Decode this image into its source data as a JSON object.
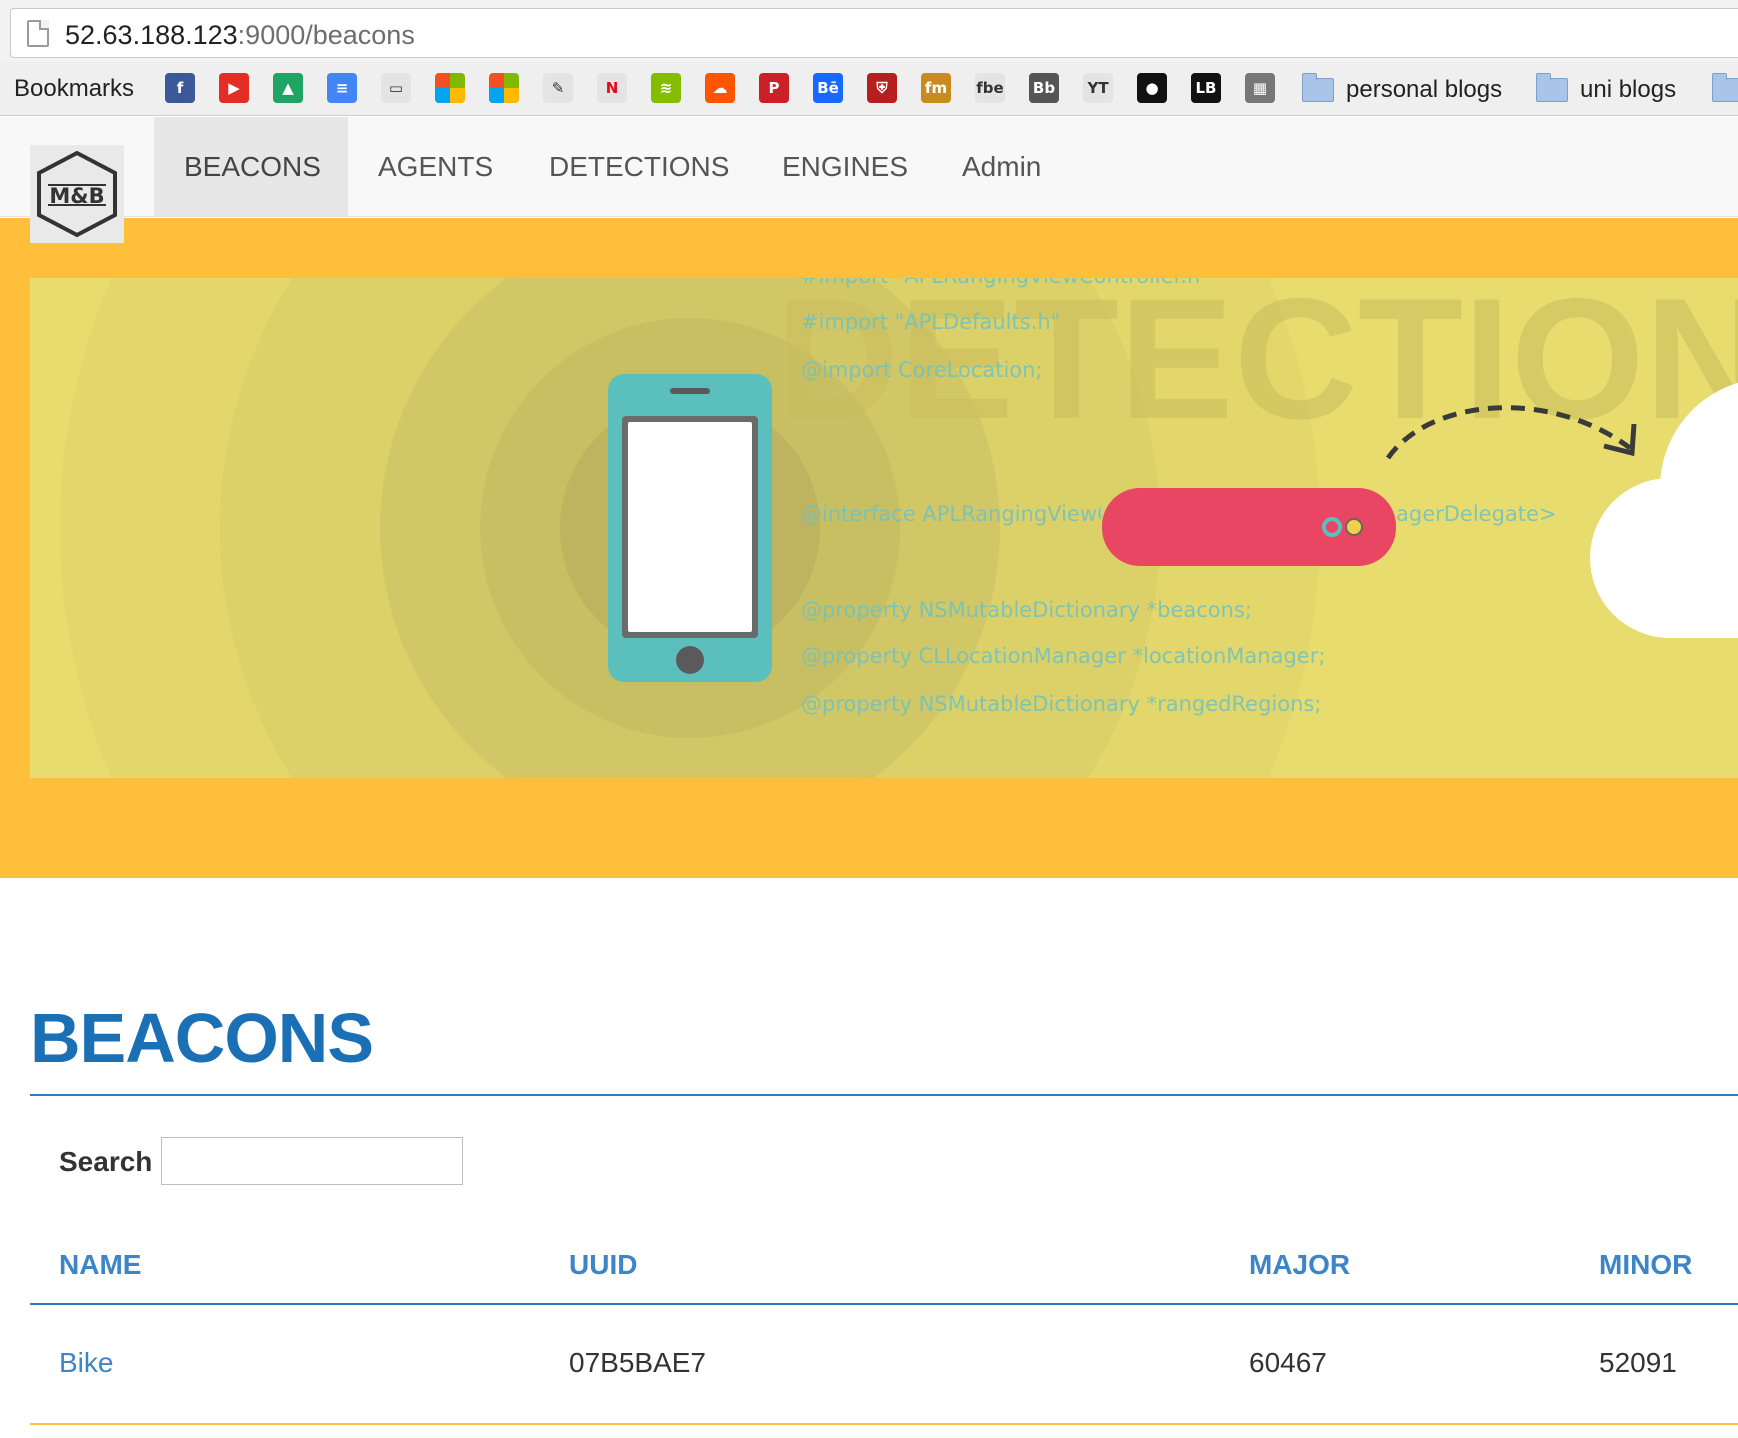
{
  "browser": {
    "url_host": "52.63.188.123",
    "url_path": ":9000/beacons",
    "bookmarks_label": "Bookmarks",
    "bookmark_icons": [
      {
        "name": "facebook-icon",
        "glyph": "f",
        "color": "#3b5998"
      },
      {
        "name": "youtube-icon",
        "glyph": "▶",
        "color": "#e52d27"
      },
      {
        "name": "google-drive-icon",
        "glyph": "▲",
        "color": "#1fa463"
      },
      {
        "name": "google-docs-icon",
        "glyph": "≡",
        "color": "#4285f4"
      },
      {
        "name": "google-slides-icon",
        "glyph": "▭",
        "color": "#f4b400"
      },
      {
        "name": "microsoft-icon-1",
        "glyph": "",
        "color": "#f25022"
      },
      {
        "name": "microsoft-icon-2",
        "glyph": "",
        "color": "#7fba00"
      },
      {
        "name": "pencil-icon",
        "glyph": "✎",
        "color": "#f4d000"
      },
      {
        "name": "netflix-icon",
        "glyph": "N",
        "color": "#ffffff"
      },
      {
        "name": "spotify-icon",
        "glyph": "≋",
        "color": "#84bd00"
      },
      {
        "name": "soundcloud-icon",
        "glyph": "☁",
        "color": "#ff5500"
      },
      {
        "name": "pinterest-icon",
        "glyph": "P",
        "color": "#cb2027"
      },
      {
        "name": "behance-icon",
        "glyph": "Bē",
        "color": "#1769ff"
      },
      {
        "name": "crest-icon",
        "glyph": "⛨",
        "color": "#b51f1f"
      },
      {
        "name": "fm-icon",
        "glyph": "fm",
        "color": "#c98b1f"
      },
      {
        "name": "fbe-icon",
        "glyph": "fbe",
        "color": "#ffffff"
      },
      {
        "name": "blackboard-icon",
        "glyph": "Bb",
        "color": "#555555"
      },
      {
        "name": "yt-mp3-icon",
        "glyph": "YT",
        "color": "#ffffff"
      },
      {
        "name": "circle-icon",
        "glyph": "●",
        "color": "#111111"
      },
      {
        "name": "lb-icon",
        "glyph": "LB",
        "color": "#111111"
      },
      {
        "name": "photo-icon",
        "glyph": "▦",
        "color": "#777777"
      }
    ],
    "folders": [
      "personal blogs",
      "uni blogs"
    ]
  },
  "nav": {
    "logo_text": "M&B",
    "items": [
      "BEACONS",
      "AGENTS",
      "DETECTIONS",
      "ENGINES",
      "Admin"
    ],
    "active_index": 0
  },
  "hero": {
    "watermark": "DETECTION",
    "code_lines": [
      "#import \"APLRangingViewController.h\"",
      "#import \"APLDefaults.h\"",
      "@import CoreLocation;",
      "@interface APLRangingViewC",
      "agerDelegate>",
      "@property NSMutableDictionary *beacons;",
      "@property CLLocationManager *locationManager;",
      "@property NSMutableDictionary *rangedRegions;"
    ],
    "colors": {
      "outer": "#ffbf3a",
      "inner": "#e8dc6f",
      "phone": "#5bbfbd",
      "beacon": "#e84662",
      "cloud": "#ffffff"
    }
  },
  "main": {
    "title": "BEACONS",
    "search_label": "Search",
    "search_value": "",
    "table": {
      "headers": [
        "NAME",
        "UUID",
        "MAJOR",
        "MINOR"
      ],
      "rows": [
        [
          "Bike",
          "07B5BAE7",
          "60467",
          "52091"
        ]
      ]
    }
  }
}
